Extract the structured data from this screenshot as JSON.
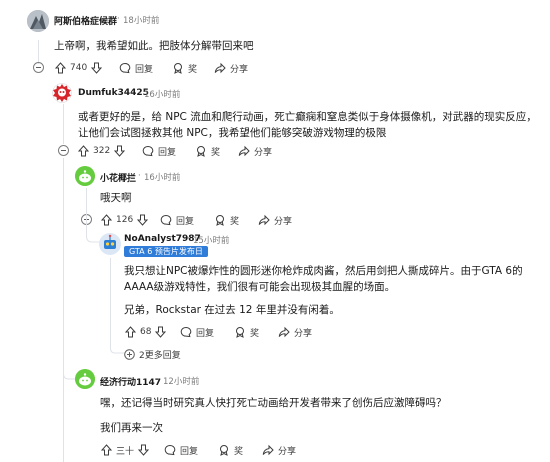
{
  "comments": [
    {
      "username": "阿斯伯格症候群",
      "time": "18小时前",
      "body": "上帝啊，我希望如此。把肢体分解带回来吧",
      "votes": "740",
      "reply": "回复",
      "award": "奖",
      "share": "分享"
    },
    {
      "username": "Dumfuk34425",
      "time": "16小时前",
      "body": "或者更好的是，给 NPC 流血和爬行动画，死亡癫痫和窒息类似于身体摄像机，对武器的现实反应，让他们会试图拯救其他 NPC，我希望他们能够突破游戏物理的极限",
      "votes": "322",
      "reply": "回复",
      "award": "奖",
      "share": "分享"
    },
    {
      "username": "小花椰拦",
      "time": "16小时前",
      "body": "哦天啊",
      "votes": "126",
      "reply": "回复",
      "award": "奖",
      "share": "分享"
    },
    {
      "username": "NoAnalyst7987",
      "time": "15小时前",
      "flair": "GTA 6 预告片发布日",
      "body1": "我只想让NPC被爆炸性的圆形迷你枪炸成肉酱，然后用剑把人撕成碎片。由于GTA 6的AAAA级游戏特性，我们很有可能会出现极其血腥的场面。",
      "body2": "兄弟，Rockstar 在过去 12 年里并没有闲着。",
      "votes": "68",
      "reply": "回复",
      "award": "奖",
      "share": "分享",
      "more_replies": "2更多回复"
    },
    {
      "username": "经济行动1147",
      "time": "12小时前",
      "body1": "嘿，还记得当时研究真人快打死亡动画给开发者带来了创伤后应激障碍吗？",
      "body2": "我们再来一次",
      "votes": "三十",
      "reply": "回复",
      "award": "奖",
      "share": "分享"
    }
  ],
  "separator": "·",
  "icons": [
    "upvote-icon",
    "downvote-icon",
    "comment-icon",
    "award-icon",
    "share-icon",
    "collapse-icon",
    "add-icon"
  ],
  "colors": {
    "flair": "#2f7cd9",
    "thread_line": "#dfe3e8",
    "text": "#1a1a1b",
    "muted": "#7c7c7c"
  }
}
